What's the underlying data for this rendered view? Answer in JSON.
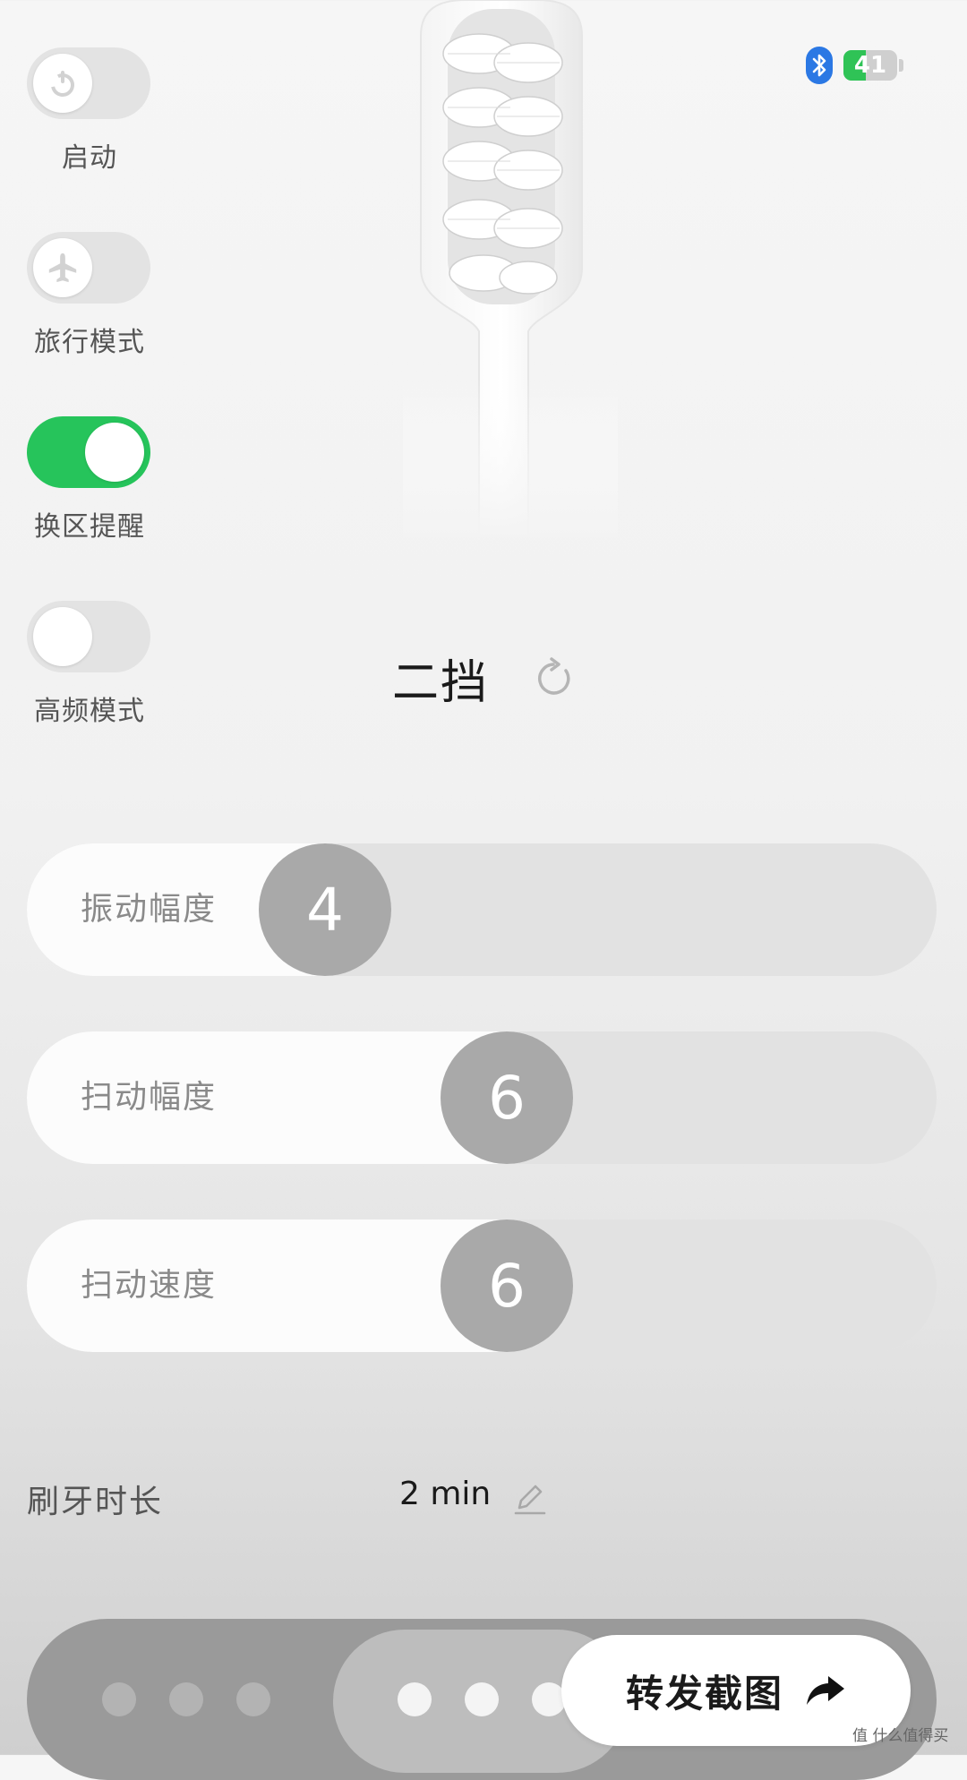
{
  "status": {
    "battery_level": 41,
    "battery_text": "41",
    "bluetooth_icon": "bluetooth-icon",
    "colors": {
      "bluetooth": "#2b78e4",
      "battery": "#2fc356"
    }
  },
  "toggles": [
    {
      "label": "启动",
      "on": false,
      "icon": "power-icon"
    },
    {
      "label": "旅行模式",
      "on": false,
      "icon": "airplane-icon"
    },
    {
      "label": "换区提醒",
      "on": true,
      "icon": ""
    },
    {
      "label": "高频模式",
      "on": false,
      "icon": ""
    }
  ],
  "mode": {
    "text": "二挡",
    "icon": "refresh-icon"
  },
  "sliders": [
    {
      "label": "振动幅度",
      "value": "4",
      "fraction": 0.0
    },
    {
      "label": "扫动幅度",
      "value": "6",
      "fraction": 0.23
    },
    {
      "label": "扫动速度",
      "value": "6",
      "fraction": 0.23
    }
  ],
  "duration": {
    "label": "刷牙时长",
    "value": "2 min",
    "icon": "edit-icon"
  },
  "pager": {
    "dots": 6,
    "active_group": 2
  },
  "share": {
    "label": "转发截图",
    "icon": "share-arrow-icon"
  },
  "watermark": "值 什么值得买",
  "colors": {
    "accent_green": "#26c45b",
    "thumb_gray": "#a9a9a9"
  }
}
